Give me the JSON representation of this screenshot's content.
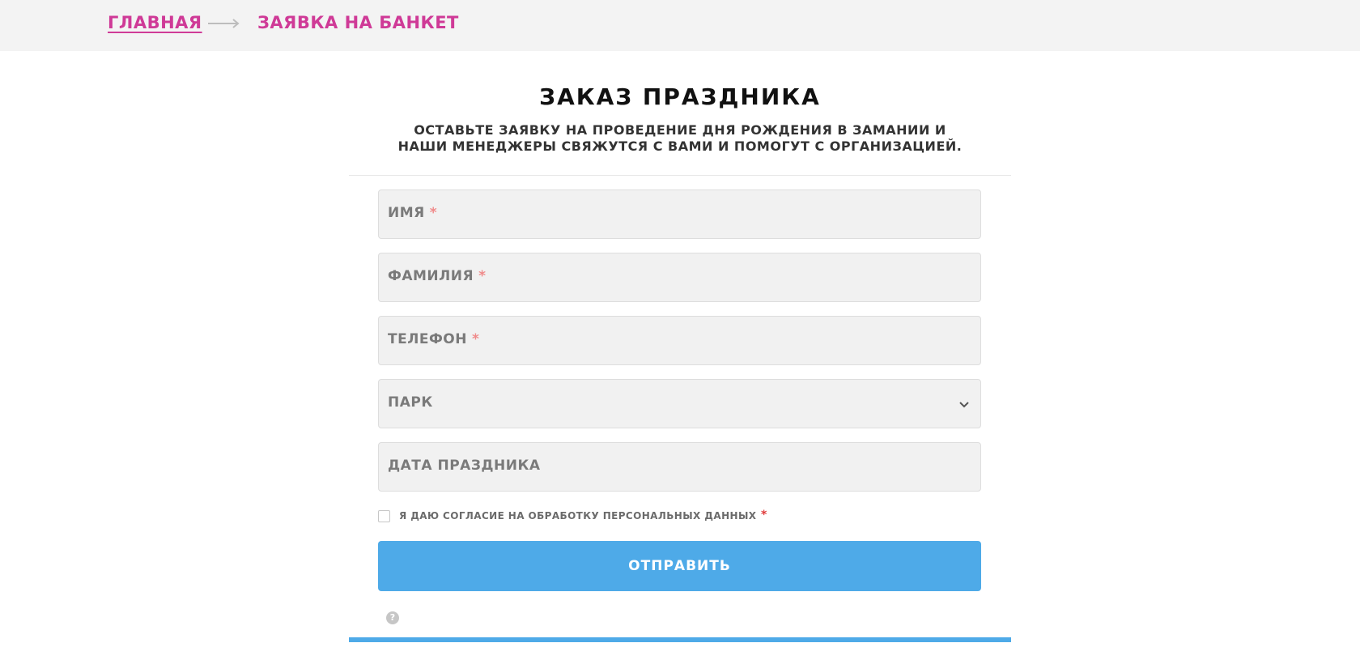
{
  "breadcrumb": {
    "home_label": "ГЛАВНАЯ",
    "current_label": "ЗАЯВКА НА БАНКЕТ"
  },
  "form": {
    "title": "ЗАКАЗ ПРАЗДНИКА",
    "subtitle": "ОСТАВЬТЕ ЗАЯВКУ НА ПРОВЕДЕНИЕ ДНЯ РОЖДЕНИЯ В ЗАМАНИИ И НАШИ МЕНЕДЖЕРЫ СВЯЖУТСЯ С ВАМИ И ПОМОГУТ С ОРГАНИЗАЦИЕЙ.",
    "fields": {
      "first_name": {
        "label": "ИМЯ",
        "required_mark": "*"
      },
      "last_name": {
        "label": "ФАМИЛИЯ",
        "required_mark": "*"
      },
      "phone": {
        "label": "ТЕЛЕФОН",
        "required_mark": "*"
      },
      "park": {
        "label": "ПАРК"
      },
      "date": {
        "label": "ДАТА ПРАЗДНИКА"
      }
    },
    "consent": {
      "label": "Я ДАЮ СОГЛАСИЕ НА ОБРАБОТКУ ПЕРСОНАЛЬНЫХ ДАННЫХ",
      "required_mark": "*"
    },
    "submit_label": "ОТПРАВИТЬ",
    "help_glyph": "?"
  },
  "icons": {
    "arrow": "arrow-right-icon",
    "dropdown": "chevron-down-icon",
    "help": "question-circle-icon"
  },
  "colors": {
    "accent_pink": "#cf3a97",
    "button_blue": "#4eaae8",
    "field_bg": "#f1f1f1",
    "required_red": "#e03a3a"
  }
}
